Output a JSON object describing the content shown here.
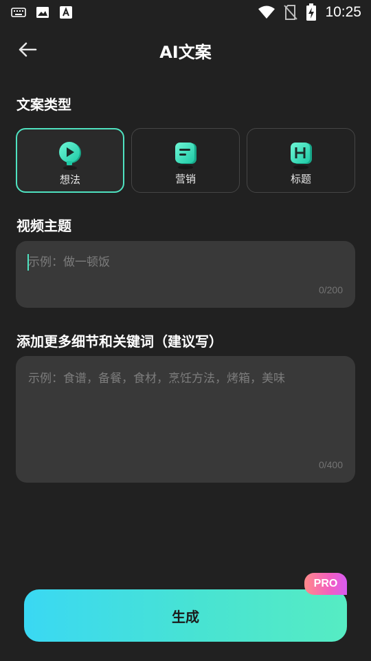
{
  "status_bar": {
    "time": "10:25",
    "icons_left": [
      "keyboard-icon",
      "image-icon",
      "font-icon"
    ],
    "icons_right": [
      "wifi-icon",
      "no-sim-icon",
      "battery-charging-icon"
    ]
  },
  "header": {
    "title": "AI文案",
    "back_icon": "arrow-left-icon"
  },
  "copy_type": {
    "label": "文案类型",
    "accent_color": "#4fe3c1",
    "options": [
      {
        "label": "想法",
        "icon": "idea-play-icon",
        "selected": true
      },
      {
        "label": "营销",
        "icon": "marketing-card-icon",
        "selected": false
      },
      {
        "label": "标题",
        "icon": "title-h-icon",
        "selected": false
      }
    ]
  },
  "video_topic": {
    "label": "视频主题",
    "value": "",
    "placeholder": "示例：做一顿饭",
    "counter": "0/200"
  },
  "details": {
    "label": "添加更多细节和关键词（建议写）",
    "value": "",
    "placeholder": "示例：食谱，备餐，食材，烹饪方法，烤箱，美味",
    "counter": "0/400"
  },
  "generate": {
    "label": "生成",
    "badge": "PRO"
  }
}
